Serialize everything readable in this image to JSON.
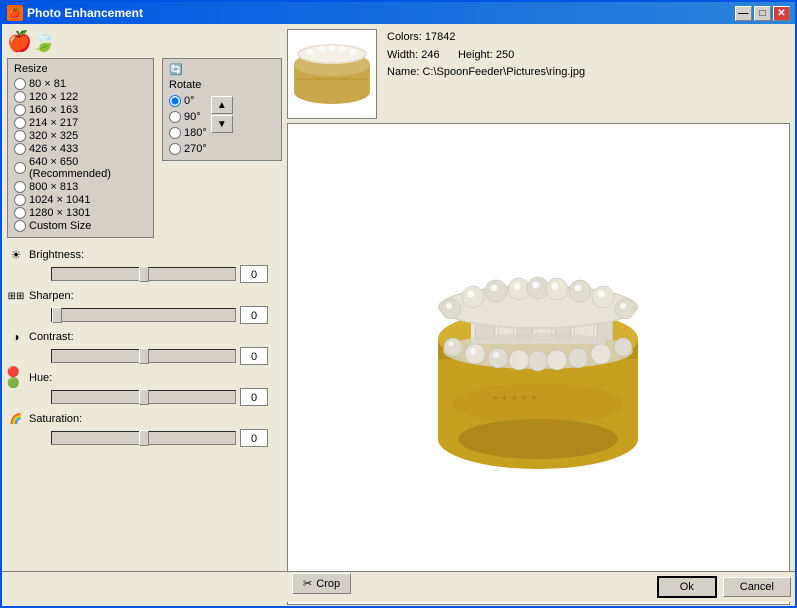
{
  "window": {
    "title": "Photo Enhancement",
    "title_icon": "🖼"
  },
  "title_buttons": {
    "minimize": "—",
    "maximize": "□",
    "close": "✕"
  },
  "resize": {
    "label": "Resize",
    "options": [
      {
        "label": "80 × 81",
        "value": "80x81",
        "selected": false
      },
      {
        "label": "120 × 122",
        "value": "120x122",
        "selected": false
      },
      {
        "label": "160 × 163",
        "value": "160x163",
        "selected": false
      },
      {
        "label": "214 × 217",
        "value": "214x217",
        "selected": false
      },
      {
        "label": "320 × 325",
        "value": "320x325",
        "selected": false
      },
      {
        "label": "426 × 433",
        "value": "426x433",
        "selected": false
      },
      {
        "label": "640 × 650 (Recommended)",
        "value": "640x650",
        "selected": false
      },
      {
        "label": "800 × 813",
        "value": "800x813",
        "selected": false
      },
      {
        "label": "1024 × 1041",
        "value": "1024x1041",
        "selected": false
      },
      {
        "label": "1280 × 1301",
        "value": "1280x1301",
        "selected": false
      },
      {
        "label": "Custom Size",
        "value": "custom",
        "selected": false
      }
    ]
  },
  "rotate": {
    "label": "Rotate",
    "options": [
      {
        "label": "0°",
        "value": "0",
        "selected": true
      },
      {
        "label": "90°",
        "value": "90",
        "selected": false
      },
      {
        "label": "180°",
        "value": "180",
        "selected": false
      },
      {
        "label": "270°",
        "value": "270",
        "selected": false
      }
    ]
  },
  "image_info": {
    "colors": "Colors: 17842",
    "width": "Width: 246",
    "height": "Height: 250",
    "name": "Name: C:\\SpoonFeeder\\Pictures\\ring.jpg"
  },
  "sliders": [
    {
      "label": "Brightness:",
      "icon": "☀",
      "value": "0",
      "min": -100,
      "max": 100,
      "current": 50
    },
    {
      "label": "Sharpen:",
      "icon": "🔍",
      "value": "0",
      "min": 0,
      "max": 100,
      "current": 0
    },
    {
      "label": "Contrast:",
      "icon": "◑",
      "value": "0",
      "min": -100,
      "max": 100,
      "current": 50
    },
    {
      "label": "Hue:",
      "icon": "🎨",
      "value": "0",
      "min": -180,
      "max": 180,
      "current": 50
    },
    {
      "label": "Saturation:",
      "icon": "💧",
      "value": "0",
      "min": -100,
      "max": 100,
      "current": 50
    }
  ],
  "buttons": {
    "crop": "Crop",
    "ok": "Ok",
    "cancel": "Cancel"
  }
}
